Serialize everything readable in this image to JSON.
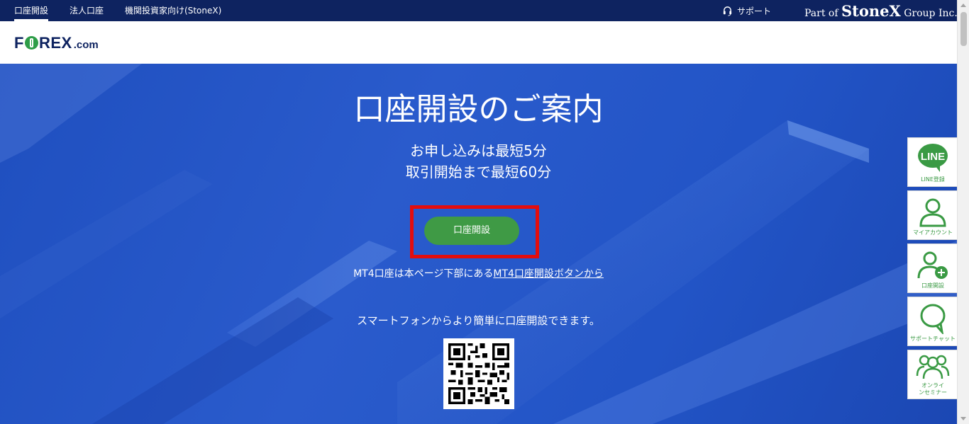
{
  "topbar": {
    "nav": [
      "口座開設",
      "法人口座",
      "機関投資家向け(StoneX)"
    ],
    "support": "サポート",
    "partof_prefix": "Part of ",
    "partof_brand": "StoneX",
    "partof_suffix": " Group Inc."
  },
  "logo": {
    "pre": "F",
    "post": "REX",
    "domain": ".com"
  },
  "hero": {
    "title": "口座開設のご案内",
    "sub1": "お申し込みは最短5分",
    "sub2": "取引開始まで最短60分",
    "cta": "口座開設",
    "mt4_text": "MT4口座は本ページ下部にある",
    "mt4_link": "MT4口座開設ボタンから",
    "smart": "スマートフォンからより簡単に口座開設できます。"
  },
  "side": {
    "line_logo": "LINE",
    "line": "LINE登録",
    "account": "マイアカウント",
    "open": "口座開設",
    "chat": "サポートチャット",
    "seminar1": "オンライ",
    "seminar2": "ンセミナー"
  },
  "colors": {
    "navy": "#0e2360",
    "green": "#3f9a45",
    "highlight": "#e40d0d",
    "hero_blue": "#2a5bcc"
  },
  "icons": [
    "headset-icon",
    "line-icon",
    "user-icon",
    "user-plus-icon",
    "chat-bubble-icon",
    "group-icon",
    "qr-code"
  ]
}
